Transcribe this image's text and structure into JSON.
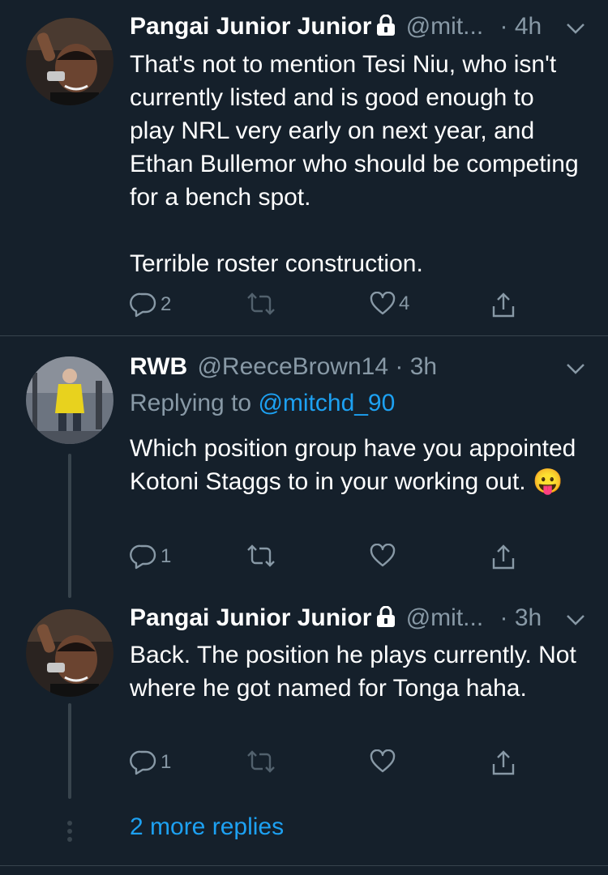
{
  "tweets": [
    {
      "name": "Pangai Junior Junior",
      "handle": "@mit...",
      "time": "· 4h",
      "locked": true,
      "body": "That's not to mention Tesi Niu, who isn't currently listed and is good enough to play NRL very early on next year, and Ethan Bullemor who should be competing for a bench spot.\n\nTerrible roster construction.",
      "reply_count": "2",
      "retweet_count": "",
      "like_count": "4"
    },
    {
      "name": "RWB",
      "handle": "@ReeceBrown14",
      "time": "· 3h",
      "locked": false,
      "replying_prefix": "Replying to",
      "replying_to": "@mitchd_90",
      "body": "Which position group have you appointed Kotoni Staggs to in your working out. 😛",
      "reply_count": "1",
      "retweet_count": "",
      "like_count": ""
    },
    {
      "name": "Pangai Junior Junior",
      "handle": "@mit...",
      "time": "· 3h",
      "locked": true,
      "body": "Back. The position he plays currently. Not where he got named for Tonga haha.",
      "reply_count": "1",
      "retweet_count": "",
      "like_count": ""
    }
  ],
  "more_replies": "2 more replies",
  "icons": {
    "reply": "reply-icon",
    "retweet": "retweet-icon",
    "like": "heart-icon",
    "share": "share-icon",
    "lock": "lock-icon",
    "caret": "chevron-down-icon"
  },
  "colors": {
    "background": "#15202b",
    "secondary_text": "#8899a6",
    "accent": "#1da1f2",
    "divider": "#38444d"
  }
}
